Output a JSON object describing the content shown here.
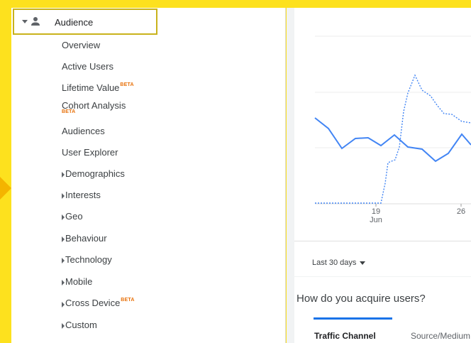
{
  "sidebar": {
    "audience_label": "Audience",
    "items": [
      {
        "label": "Overview"
      },
      {
        "label": "Active Users"
      },
      {
        "label": "Lifetime Value",
        "badge": "BETA"
      },
      {
        "label": "Cohort Analysis",
        "badge": "BETA"
      },
      {
        "label": "Audiences"
      },
      {
        "label": "User Explorer"
      },
      {
        "label": "Demographics"
      },
      {
        "label": "Interests"
      },
      {
        "label": "Geo"
      },
      {
        "label": "Behaviour"
      },
      {
        "label": "Technology"
      },
      {
        "label": "Mobile"
      },
      {
        "label": "Cross Device",
        "badge": "BETA"
      },
      {
        "label": "Custom"
      }
    ]
  },
  "chart": {
    "x_ticks": [
      {
        "day": "19",
        "month": "Jun"
      },
      {
        "day": "26",
        "month": ""
      }
    ],
    "series_solid_color": "#4285f4",
    "series_dotted_color": "#4285f4"
  },
  "date_range": {
    "label": "Last 30 days"
  },
  "acquisition": {
    "question": "How do you acquire users?",
    "tabs": [
      "Traffic Channel",
      "Source/Medium"
    ]
  },
  "colors": {
    "highlight_yellow": "#fde11e",
    "arrow_amber": "#f4b400",
    "beta_orange": "#e8710a",
    "tab_blue": "#1a73e8"
  }
}
